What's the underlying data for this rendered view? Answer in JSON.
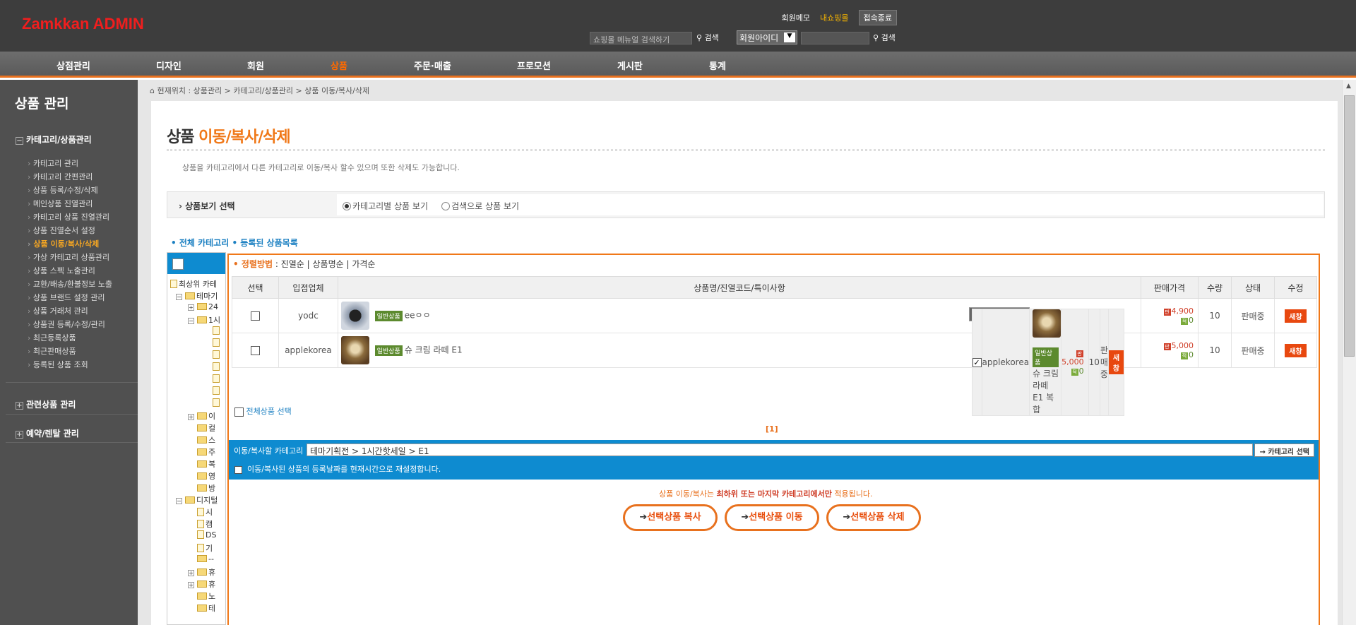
{
  "header": {
    "logo": "Zamkkan ADMIN",
    "links": [
      "회원메모",
      "내쇼핑몰",
      "접속종료"
    ],
    "menu_search_placeholder": "쇼핑몰 메뉴얼 검색하기",
    "search_label": "검색",
    "member_select": "회원아이디",
    "search_label2": "검색"
  },
  "nav": [
    "상점관리",
    "디자인",
    "회원",
    "상품",
    "주문·매출",
    "프로모션",
    "게시판",
    "통계"
  ],
  "sidebar": {
    "title": "상품 관리",
    "group1": "카테고리/상품관리",
    "items": [
      "카테고리 관리",
      "카테고리 간편관리",
      "상품 등록/수정/삭제",
      "메인상품 진열관리",
      "카테고리 상품 진열관리",
      "상품 진열순서 설정",
      "상품 이동/복사/삭제",
      "가상 카테고리 상품관리",
      "상품 스펙 노출관리",
      "교환/배송/환불정보 노출",
      "상품 브랜드 설정 관리",
      "상품 거래처 관리",
      "상품권 등록/수정/관리",
      "최근등록상품",
      "최근판매상품",
      "등록된 상품 조회"
    ],
    "group2": "관련상품 관리",
    "group3": "예약/렌탈 관리"
  },
  "breadcrumb": "현재위치 : 상품관리 > 카테고리/상품관리 > 상품 이동/복사/삭제",
  "page": {
    "title_a": "상품",
    "title_b": "이동/복사/삭제",
    "desc": "상품을 카테고리에서 다른 카테고리로 이동/복사 할수 있으며 또한 삭제도 가능합니다.",
    "view_label": "상품보기 선택",
    "view_opt1": "카테고리별 상품 보기",
    "view_opt2": "검색으로 상품 보기",
    "subtabs": "• 전체 카테고리  • 등록된 상품목록"
  },
  "tree": [
    "최상위 카테",
    "테마기",
    "24",
    "1시",
    "이",
    "컬",
    "스",
    "주",
    "복",
    "영",
    "방",
    "디지털",
    "시",
    "캠",
    "DS",
    "기",
    "--",
    "휴",
    "휴",
    "노",
    "테"
  ],
  "table": {
    "sort_title": "정렬방법",
    "sort_opts": ": 진열순 | 상품명순 | 가격순",
    "headers": [
      "선택",
      "입점업체",
      "상품명/진열코드/특이사항",
      "판매가격",
      "수량",
      "상태",
      "수정"
    ],
    "rows": [
      {
        "check": "",
        "vendor": "yodc",
        "badge": "일반상품",
        "name": "eeㅇㅇ",
        "price": "4,900",
        "point": "0",
        "qty": "10",
        "status": "판매중",
        "edit": "새창"
      },
      {
        "check": "",
        "vendor": "applekorea",
        "badge": "일반상품",
        "name": "슈 크림 라떼 E1",
        "price": "5,000",
        "point": "0",
        "qty": "10",
        "status": "판매중",
        "edit": "새창"
      },
      {
        "check": "✓",
        "vendor": "applekorea",
        "badge": "일반상품",
        "name": "슈 크림 라떼 E1 복합",
        "price": "5,000",
        "point": "0",
        "qty": "10",
        "status": "판매중",
        "edit": "새창"
      }
    ],
    "select_all": "전체상품 선택",
    "pager": "[1]"
  },
  "move": {
    "label": "이동/복사할 카테고리",
    "value": "테마기획전 > 1시간핫세일 > E1",
    "cat_button": "→ 카테고리 선택",
    "reset_label": "이동/복사된 상품의 등록날짜를 현재시간으로 재설정합니다."
  },
  "note_a": "상품 이동/복사는",
  "note_b": "최하위 또는 마지막 카테고리에서만",
  "note_c": "적용됩니다.",
  "actions": [
    "선택상품 복사",
    "선택상품 이동",
    "선택상품 삭제"
  ]
}
